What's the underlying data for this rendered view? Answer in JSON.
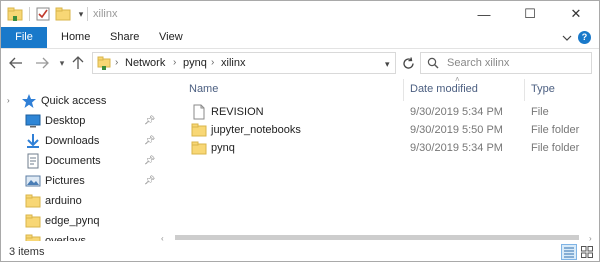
{
  "window": {
    "title": "xilinx",
    "controls": {
      "minimize": "—",
      "maximize": "☐",
      "close": "✕"
    }
  },
  "ribbon": {
    "tabs": [
      "File",
      "Home",
      "Share",
      "View"
    ],
    "help": "?"
  },
  "address": {
    "crumbs": [
      "Network",
      "pynq",
      "xilinx"
    ]
  },
  "search": {
    "placeholder": "Search xilinx"
  },
  "nav_pane": {
    "quick_access": "Quick access",
    "items": [
      {
        "label": "Desktop",
        "icon": "desktop-icon",
        "pinned": true
      },
      {
        "label": "Downloads",
        "icon": "downloads-icon",
        "pinned": true
      },
      {
        "label": "Documents",
        "icon": "documents-icon",
        "pinned": true
      },
      {
        "label": "Pictures",
        "icon": "pictures-icon",
        "pinned": true
      },
      {
        "label": "arduino",
        "icon": "folder-icon",
        "pinned": false
      },
      {
        "label": "edge_pynq",
        "icon": "folder-icon",
        "pinned": false
      },
      {
        "label": "overlays",
        "icon": "folder-icon",
        "pinned": false
      }
    ]
  },
  "file_list": {
    "columns": {
      "name": "Name",
      "date": "Date modified",
      "type": "Type"
    },
    "rows": [
      {
        "name": "REVISION",
        "date": "9/30/2019 5:34 PM",
        "type": "File",
        "icon": "file-icon"
      },
      {
        "name": "jupyter_notebooks",
        "date": "9/30/2019 5:50 PM",
        "type": "File folder",
        "icon": "folder-icon"
      },
      {
        "name": "pynq",
        "date": "9/30/2019 5:34 PM",
        "type": "File folder",
        "icon": "folder-icon"
      }
    ]
  },
  "status": {
    "items_count": "3 items"
  },
  "colors": {
    "accent": "#1979ca",
    "folder": "#f8d775",
    "header_text": "#4d6082"
  }
}
